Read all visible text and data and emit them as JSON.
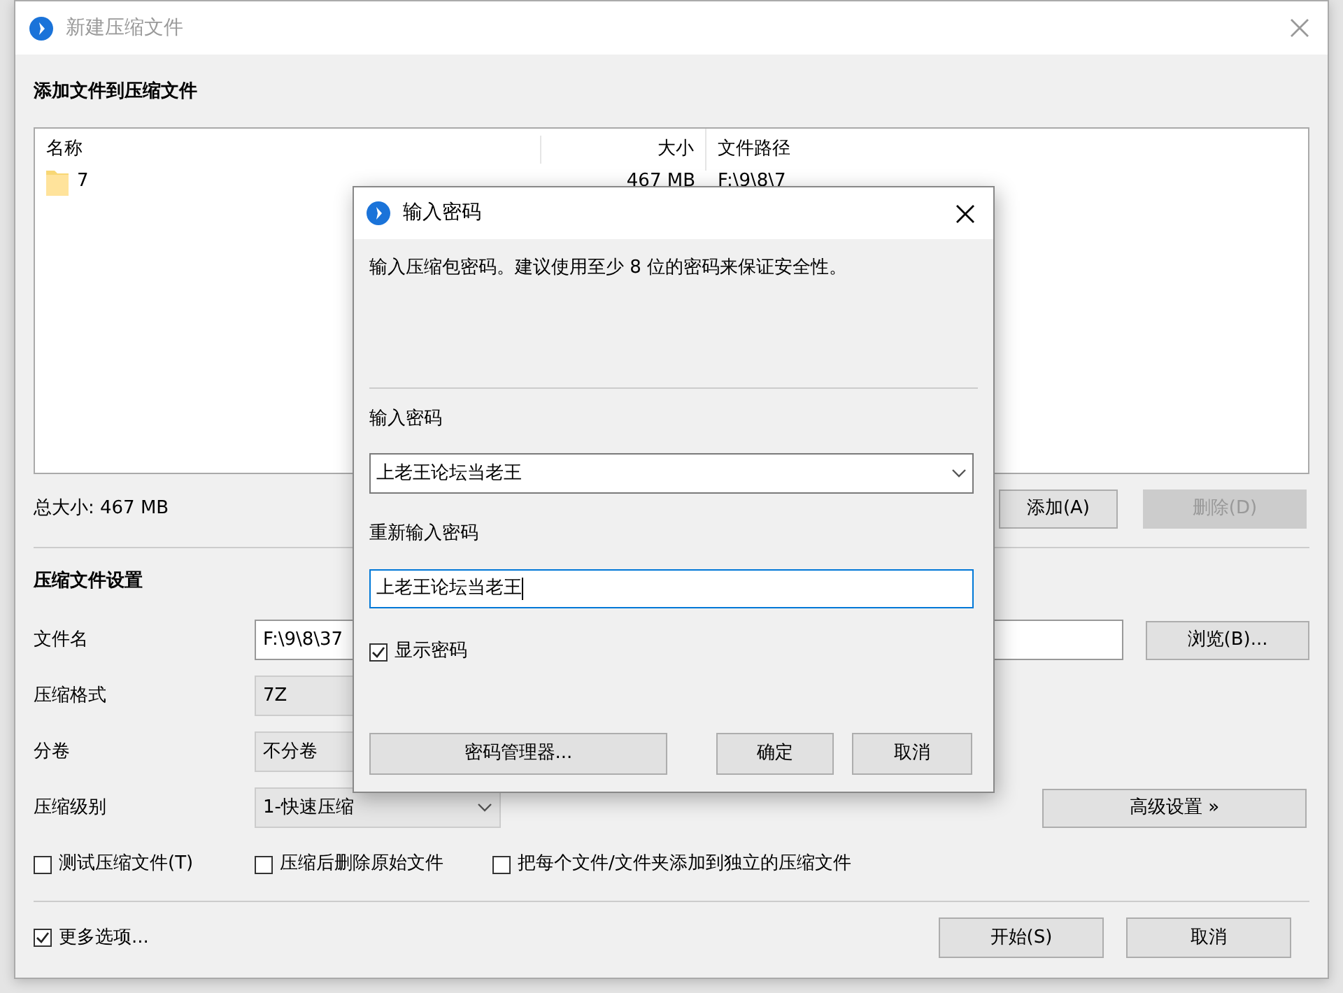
{
  "window": {
    "title": "新建压缩文件",
    "active": false
  },
  "files": {
    "heading": "添加文件到压缩文件",
    "columns": [
      "名称",
      "大小",
      "文件路径"
    ],
    "rows": [
      {
        "name": "7",
        "size": "467 MB",
        "path": "F:\\9\\8\\7"
      }
    ],
    "total": "总大小: 467 MB",
    "buttons": [
      {
        "label": "添加(A)",
        "disabled": false
      },
      {
        "label": "删除(D)",
        "disabled": true
      }
    ]
  },
  "settings": {
    "heading": "压缩文件设置",
    "fields": [
      {
        "kind": "text",
        "label": "文件名",
        "value": "F:\\9\\8\\37"
      },
      {
        "kind": "list",
        "label": "压缩格式",
        "value": "7Z"
      },
      {
        "kind": "list",
        "label": "分卷",
        "value": "不分卷"
      },
      {
        "kind": "combo",
        "label": "压缩级别",
        "value": "1-快速压缩"
      }
    ],
    "browse_button": "浏览(B)...",
    "advanced_button": "高级设置 »",
    "options": [
      {
        "label": "测试压缩文件(T)",
        "checked": false
      },
      {
        "label": "压缩后删除原始文件",
        "checked": false
      },
      {
        "label": "把每个文件/文件夹添加到独立的压缩文件",
        "checked": false
      }
    ]
  },
  "more_options": {
    "label": "更多选项...",
    "checked": true
  },
  "footer_buttons": [
    "开始(S)",
    "取消"
  ],
  "dialog": {
    "title": "输入密码",
    "message": "输入压缩包密码。建议使用至少 8 位的密码来保证安全性。",
    "fields": [
      {
        "kind": "combo",
        "label": "输入密码",
        "value": "上老王论坛当老王",
        "focused": false
      },
      {
        "kind": "text",
        "label": "重新输入密码",
        "value": "上老王论坛当老王",
        "focused": true
      }
    ],
    "show_password": {
      "label": "显示密码",
      "checked": true
    },
    "buttons": [
      "密码管理器...",
      "确定",
      "取消"
    ]
  }
}
